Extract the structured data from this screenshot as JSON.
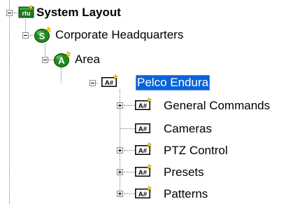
{
  "tree": {
    "root": {
      "label": "System Layout",
      "icon": "rtu-icon",
      "expanded": true
    },
    "site": {
      "label": "Corporate Headquarters",
      "icon": "site-icon",
      "expanded": true
    },
    "area": {
      "label": "Area",
      "icon": "area-icon",
      "expanded": true
    },
    "device": {
      "label": "Pelco Endura",
      "icon": "device-icon",
      "expanded": true,
      "selected": true
    },
    "children": [
      {
        "label": "General Commands",
        "icon": "device-icon",
        "expandable": true
      },
      {
        "label": "Cameras",
        "icon": "device-icon",
        "expandable": false
      },
      {
        "label": "PTZ Control",
        "icon": "device-icon",
        "expandable": true
      },
      {
        "label": "Presets",
        "icon": "device-icon",
        "expandable": true
      },
      {
        "label": "Patterns",
        "icon": "device-icon",
        "expandable": true
      }
    ],
    "icon_text": {
      "rtu": "rtu",
      "site": "S",
      "area": "A",
      "device": "A#"
    }
  },
  "colors": {
    "selection": "#0a64d8",
    "connector": "#7f7f7f",
    "rtu_badge": "#1f7a1f",
    "site_badge": "#1f8a1f",
    "spark": "#ffd800"
  }
}
